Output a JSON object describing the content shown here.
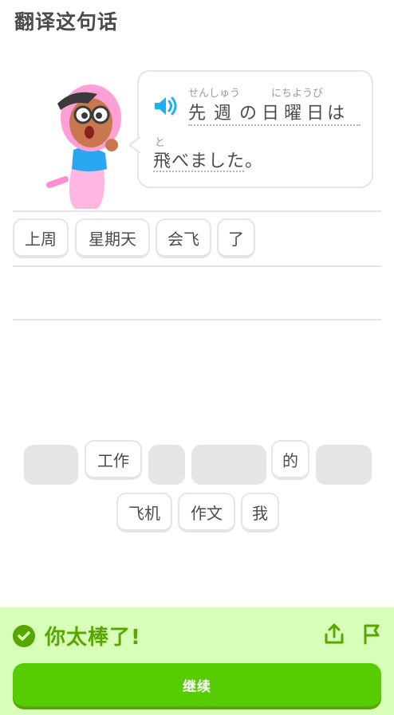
{
  "header": {
    "title": "翻译这句话"
  },
  "sentence": {
    "line1": [
      {
        "base": "先",
        "reading": ""
      },
      {
        "base": "週",
        "reading": ""
      },
      {
        "base": "の",
        "reading": ""
      },
      {
        "base": "日",
        "reading": ""
      },
      {
        "base": "曜",
        "reading": ""
      },
      {
        "base": "日",
        "reading": ""
      },
      {
        "base": "は",
        "reading": ""
      }
    ],
    "reading1": "せんしゅう",
    "reading2": "にちようび",
    "reading3": "と",
    "line2": "飛べました。"
  },
  "answer_chips": [
    "上周",
    "星期天",
    "会飞",
    "了"
  ],
  "bank": {
    "row1_word1": "工作",
    "row1_word2": "的",
    "row2": [
      "飞机",
      "作文",
      "我"
    ]
  },
  "footer": {
    "message": "你太棒了!",
    "continue_label": "继续"
  },
  "colors": {
    "green_dark": "#58a700",
    "green_button": "#58cc02",
    "footer_bg": "#d7ffb8",
    "speaker_blue": "#1cb0f6"
  },
  "icons": [
    "speaker-icon",
    "check-icon",
    "share-icon",
    "flag-icon"
  ]
}
